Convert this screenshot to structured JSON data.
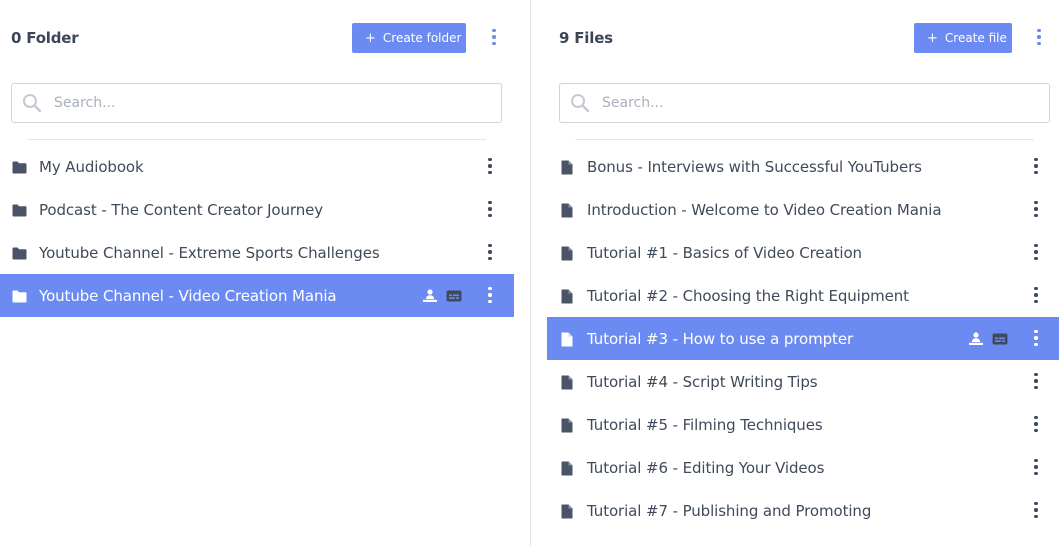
{
  "folders_panel": {
    "title": "0 Folder",
    "create_label": "Create folder",
    "create_icon": "plus-icon",
    "search_placeholder": "Search...",
    "items": [
      {
        "label": "My Audiobook",
        "icon": "folder-icon"
      },
      {
        "label": "Podcast - The Content Creator Journey",
        "icon": "folder-icon"
      },
      {
        "label": "Youtube Channel - Extreme Sports Challenges",
        "icon": "folder-icon"
      },
      {
        "label": "Youtube Channel - Video Creation Mania",
        "icon": "folder-icon",
        "selected": true,
        "badges": [
          "person-icon",
          "caption-icon"
        ]
      }
    ]
  },
  "files_panel": {
    "title": "9 Files",
    "create_label": "Create file",
    "create_icon": "plus-icon",
    "search_placeholder": "Search...",
    "items": [
      {
        "label": "Bonus - Interviews with Successful YouTubers",
        "icon": "file-icon"
      },
      {
        "label": "Introduction - Welcome to Video Creation Mania",
        "icon": "file-icon"
      },
      {
        "label": "Tutorial #1 - Basics of Video Creation",
        "icon": "file-icon"
      },
      {
        "label": "Tutorial #2 - Choosing the Right Equipment",
        "icon": "file-icon"
      },
      {
        "label": "Tutorial #3 - How to use a prompter",
        "icon": "file-icon",
        "selected": true,
        "badges": [
          "person-icon",
          "caption-icon"
        ]
      },
      {
        "label": "Tutorial #4 - Script Writing Tips",
        "icon": "file-icon"
      },
      {
        "label": "Tutorial #5 - Filming Techniques",
        "icon": "file-icon"
      },
      {
        "label": "Tutorial #6 - Editing Your Videos",
        "icon": "file-icon"
      },
      {
        "label": "Tutorial #7 - Publishing and Promoting",
        "icon": "file-icon"
      }
    ]
  },
  "colors": {
    "accent": "#6b8bf2",
    "text": "#3f4a5a",
    "selected_text": "#ffffff"
  }
}
